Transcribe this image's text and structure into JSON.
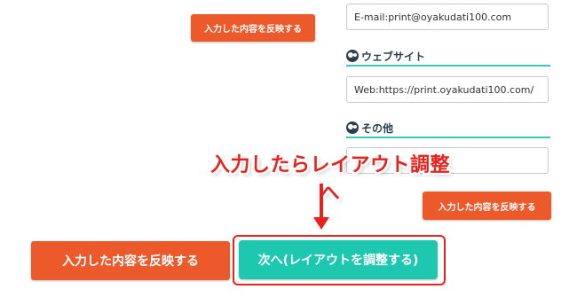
{
  "buttons": {
    "apply_label": "入力した内容を反映する",
    "next_label": "次へ(レイアウトを調整する)"
  },
  "fields": {
    "email_value": "E-mail:print@oyakudati100.com",
    "website_value": "Web:https://print.oyakudati100.com/",
    "other_value": ""
  },
  "sections": {
    "website_title": "ウェブサイト",
    "other_title": "その他"
  },
  "annotation": {
    "callout_text": "入力したらレイアウト調整へ"
  },
  "colors": {
    "orange": "#ec5a2b",
    "teal": "#1ec7b0",
    "section_line": "#3cc7b4",
    "callout_red": "#e8211c"
  }
}
